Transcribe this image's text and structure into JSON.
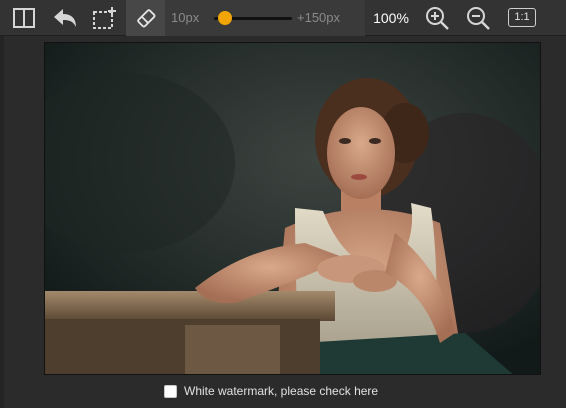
{
  "toolbar": {
    "tools": [
      {
        "icon": "split-view-icon"
      },
      {
        "icon": "undo-icon"
      },
      {
        "icon": "crop-add-icon"
      },
      {
        "icon": "eraser-icon",
        "active": true
      }
    ],
    "brush_size": {
      "min_label": "10px",
      "max_label": "+150px",
      "value_fraction": 0.14
    },
    "zoom_label": "100%",
    "zoom_in_icon": "zoom-in-icon",
    "zoom_out_icon": "zoom-out-icon",
    "ratio_label": "1:1"
  },
  "canvas": {
    "image": "portrait-photo"
  },
  "watermark": {
    "label": "White watermark, please check here",
    "checked": false
  },
  "colors": {
    "toolbar_bg": "#333333",
    "app_bg": "#2b2b2b",
    "accent": "#f0a500"
  }
}
